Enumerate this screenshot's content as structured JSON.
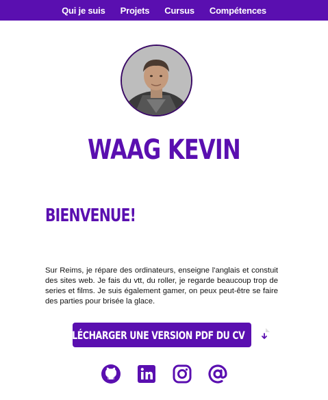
{
  "nav": {
    "items": [
      {
        "label": "Qui je suis"
      },
      {
        "label": "Projets"
      },
      {
        "label": "Cursus"
      },
      {
        "label": "Compétences"
      }
    ]
  },
  "profile": {
    "name": "WAAG KEVIN"
  },
  "intro": {
    "heading": "BIENVENUE!",
    "text": "Sur Reims, je répare des ordinateurs, enseigne l'anglais et constuit des sites web. Je fais du vtt, du roller, je regarde beaucoup trop de series et films. Je suis également gamer, on peux peut-être se faire des parties pour brisée la glace."
  },
  "cv": {
    "button_label": "TÉLÉCHARGER UNE VERSION PDF DU CV",
    "icon": "file-download-icon"
  },
  "socials": [
    {
      "icon": "github-icon"
    },
    {
      "icon": "linkedin-icon"
    },
    {
      "icon": "instagram-icon"
    },
    {
      "icon": "at-sign-icon"
    }
  ],
  "colors": {
    "accent": "#5a0fb0"
  }
}
